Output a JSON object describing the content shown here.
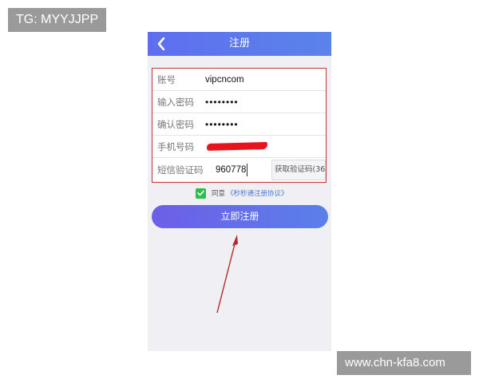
{
  "watermarks": {
    "top": "TG: MYYJJPP",
    "bottom": "www.chn-kfa8.com"
  },
  "header": {
    "title": "注册",
    "back_icon": "chevron-left-icon"
  },
  "form": {
    "account": {
      "label": "账号",
      "value": "vipcncom"
    },
    "password": {
      "label": "输入密码",
      "value": "••••••••"
    },
    "confirm_password": {
      "label": "确认密码",
      "value": "••••••••"
    },
    "phone": {
      "label": "手机号码"
    },
    "sms_code": {
      "label": "短信验证码",
      "value": "960778",
      "button": "获取验证码(36"
    }
  },
  "agreement": {
    "prefix": "同意",
    "link": "《秒秒通注册协议》",
    "checked": true
  },
  "submit": {
    "label": "立即注册"
  },
  "colors": {
    "header_gradient": [
      "#5f6ef0",
      "#5a83ea"
    ],
    "button_gradient": [
      "#6d5ee8",
      "#5a80ea"
    ],
    "highlight_border": "#c8303a",
    "checkbox": "#2bbf4a",
    "link": "#4b7ad6"
  }
}
